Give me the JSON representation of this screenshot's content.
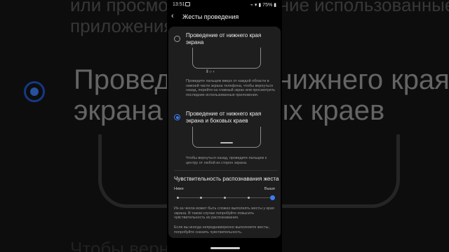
{
  "background": {
    "line1": "или просмотреть последние использованные",
    "line2": "приложения.",
    "big_option_line1": "Проведение от нижнего края",
    "big_option_line2": "экрана и боковых краев",
    "bottom_fragment": "Чтобы вернуться"
  },
  "status_bar": {
    "time": "13:51",
    "right": "⌁ ▾ ▮ 75% ▮"
  },
  "app_bar": {
    "back_icon": "back-arrow-icon",
    "title": "Жесты проведения"
  },
  "options": [
    {
      "label": "Проведение от нижнего края экрана",
      "selected": false,
      "nav_keys": "⦀   ○   ‹",
      "description": "Проведите пальцем вверх от каждой области в нижней части экрана телефона, чтобы вернуться назад, перейти на главный экран или просмотреть последние использованные приложения."
    },
    {
      "label": "Проведение от нижнего края экрана и боковых краев",
      "selected": true,
      "description": "Чтобы вернуться назад, проведите пальцем к центру от любой из сторон экрана."
    }
  ],
  "sensitivity": {
    "title": "Чувствительность распознавания жеста",
    "low_label": "Ниже",
    "high_label": "Выше",
    "steps": 5,
    "value_step": 5,
    "note1": "Из-за чехла может быть сложно выполнять жесты у края экрана. В таком случае попробуйте повысить чувствительность их распознавания.",
    "note2": "Если вы иногда непреднамеренно выполняете жесты, попробуйте снизить чувствительность."
  },
  "colors": {
    "accent": "#3b7df2",
    "card": "#1e1e1e"
  }
}
